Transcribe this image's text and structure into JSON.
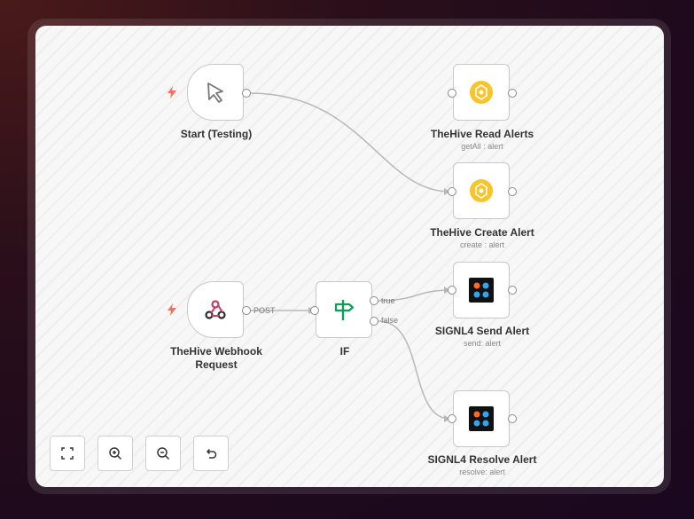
{
  "nodes": {
    "start": {
      "title": "Start (Testing)",
      "icon": "cursor-icon"
    },
    "hive_read": {
      "title": "TheHive Read Alerts",
      "subtitle": "getAll : alert",
      "icon": "thehive-icon"
    },
    "hive_create": {
      "title": "TheHive Create Alert",
      "subtitle": "create : alert",
      "icon": "thehive-icon"
    },
    "webhook": {
      "title_line1": "TheHive Webhook",
      "title_line2": "Request",
      "icon": "webhook-icon"
    },
    "if": {
      "title": "IF",
      "icon": "signpost-icon"
    },
    "signl4_send": {
      "title": "SIGNL4 Send Alert",
      "subtitle": "send: alert",
      "icon": "signl4-icon"
    },
    "signl4_resolve": {
      "title": "SIGNL4 Resolve Alert",
      "subtitle": "resolve: alert",
      "icon": "signl4-icon"
    }
  },
  "edges": {
    "webhook_if": "POST",
    "if_true": "true",
    "if_false": "false"
  },
  "controls": [
    "fit-view",
    "zoom-in",
    "zoom-out",
    "undo"
  ],
  "colors": {
    "trigger_bolt": "#ff6d5a",
    "thehive_yellow": "#f7c52b",
    "if_green": "#0f9d58",
    "webhook_pink": "#c73a63",
    "signl4_dark": "#111111"
  }
}
